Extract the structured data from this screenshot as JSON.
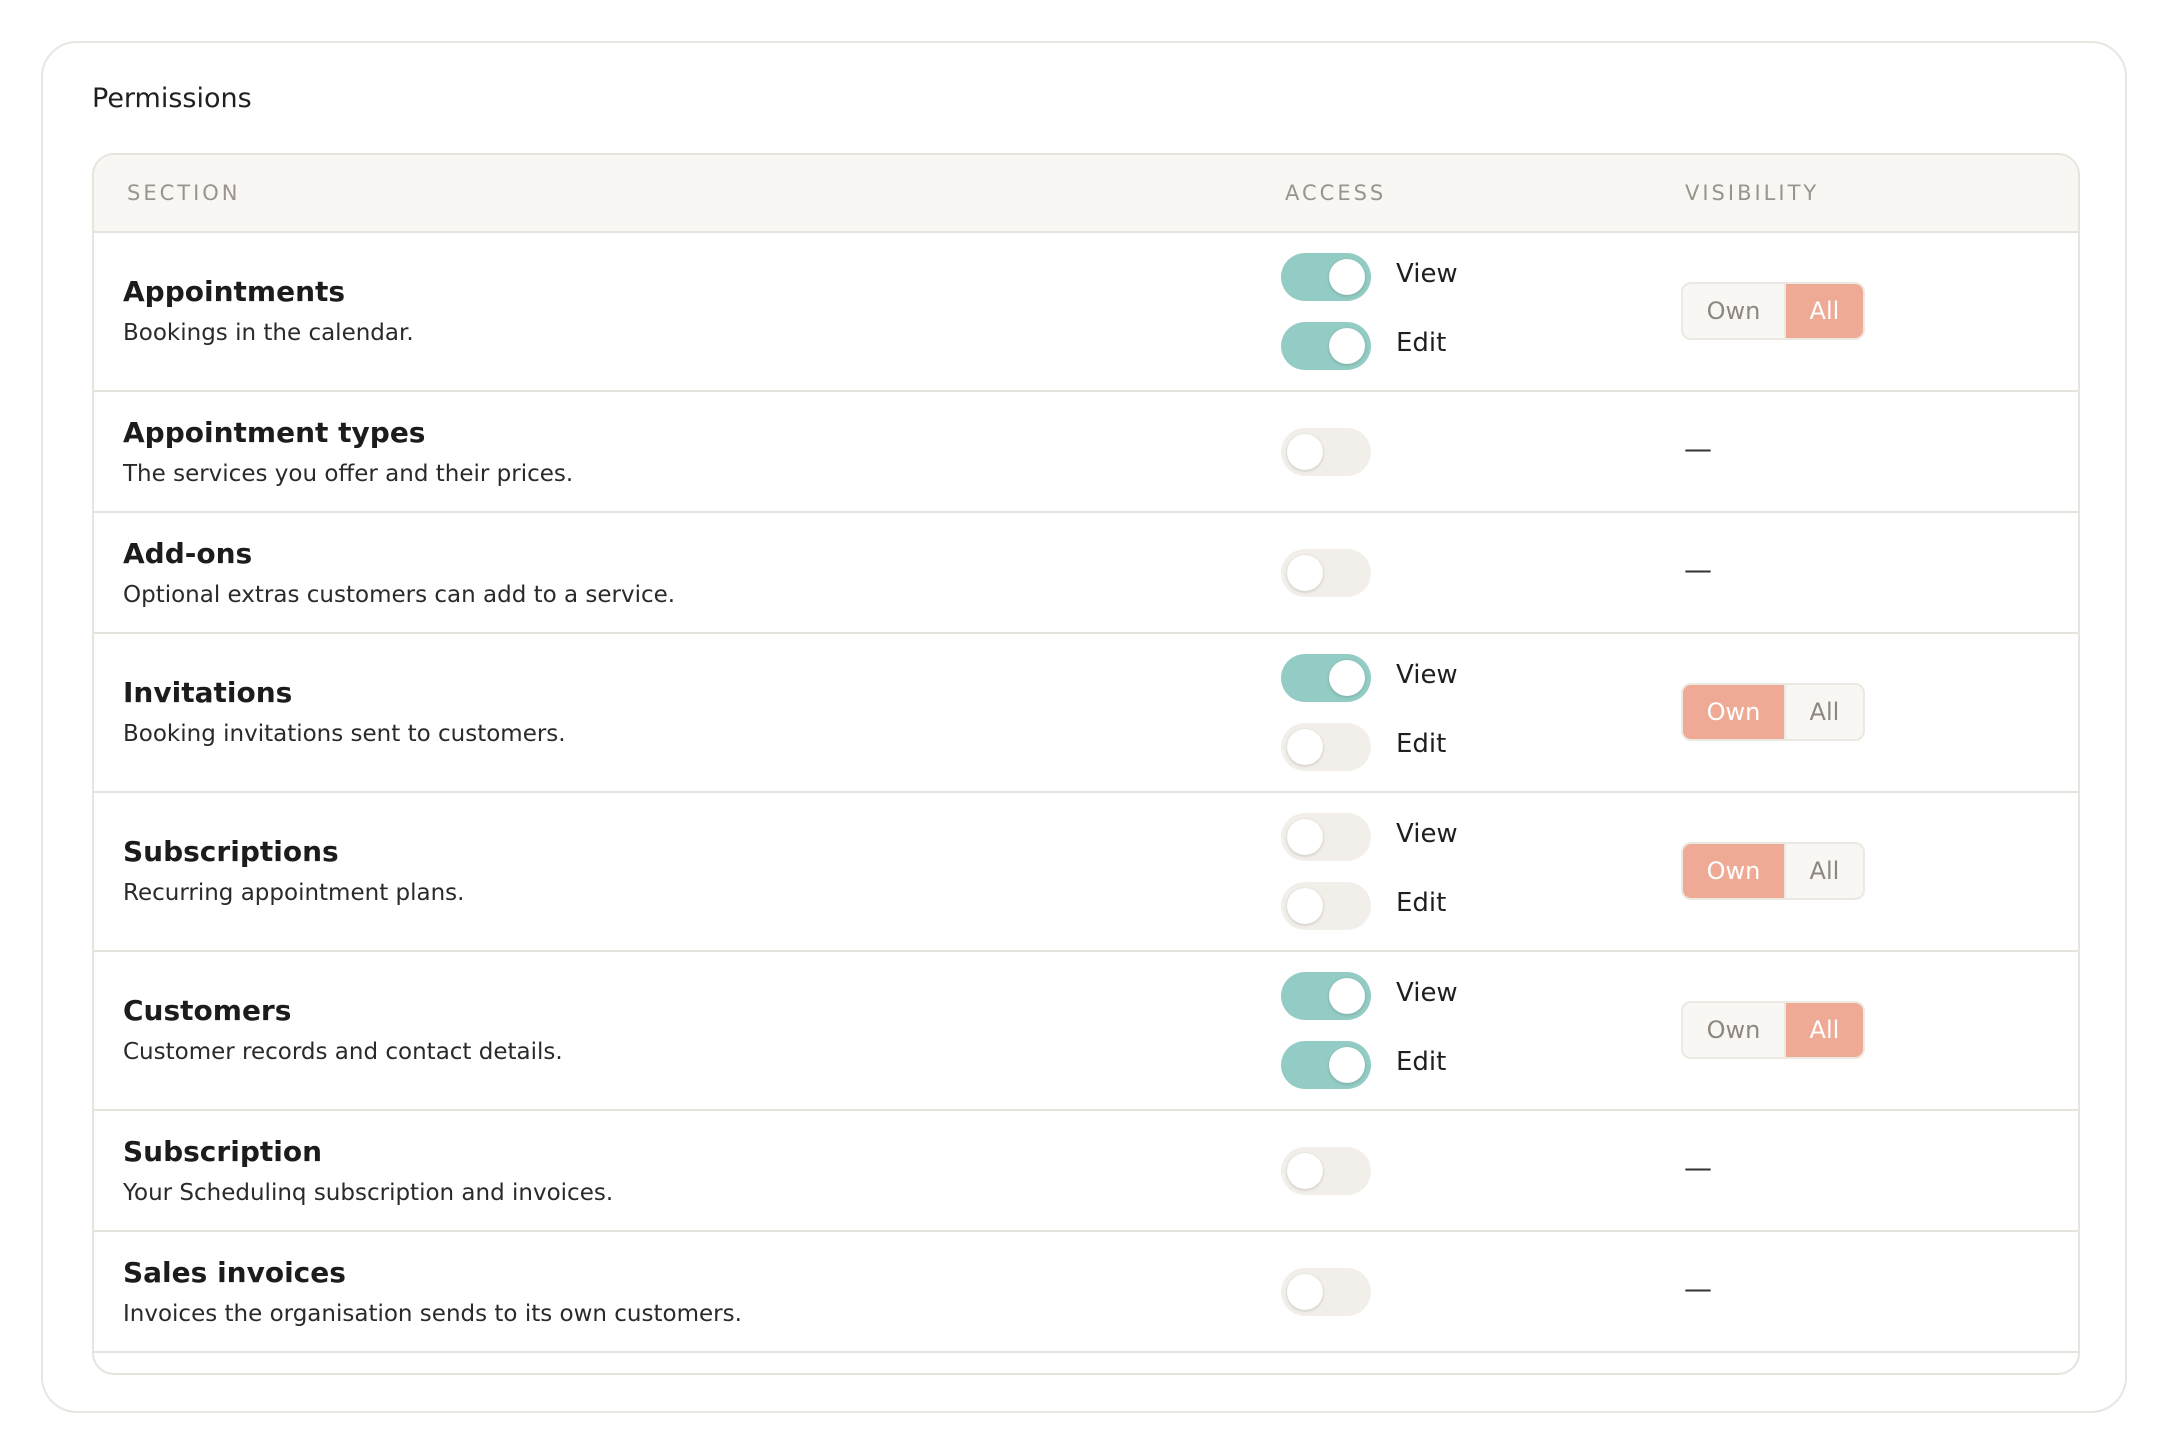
{
  "card": {
    "title": "Permissions"
  },
  "table": {
    "headers": {
      "section": "SECTION",
      "access": "ACCESS",
      "visibility": "VISIBILITY"
    },
    "rows": [
      {
        "title": "Appointments",
        "desc": "Bookings in the calendar.",
        "view": true,
        "edit": true,
        "visibility": "All"
      },
      {
        "title": "Appointment types",
        "desc": "The services you offer and their prices.",
        "enabled": false,
        "dash": "—"
      },
      {
        "title": "Add-ons",
        "desc": "Optional extras customers can add to a service.",
        "enabled": false,
        "dash": "—"
      },
      {
        "title": "Invitations",
        "desc": "Booking invitations sent to customers.",
        "view": true,
        "edit": false,
        "visibility": "Own"
      },
      {
        "title": "Subscriptions",
        "desc": "Recurring appointment plans.",
        "view": false,
        "edit": false,
        "visibility": "Own"
      },
      {
        "title": "Customers",
        "desc": "Customer records and contact details.",
        "view": true,
        "edit": true,
        "visibility": "All"
      },
      {
        "title": "Subscription",
        "desc": "Your Schedulinq subscription and invoices.",
        "enabled": false,
        "dash": "—"
      },
      {
        "title": "Sales invoices",
        "desc": "Invoices the organisation sends to its own customers.",
        "enabled": false,
        "dash": "—"
      }
    ]
  },
  "labels": {
    "view": "View",
    "edit": "Edit",
    "own": "Own",
    "all": "All"
  },
  "colors": {
    "toggle_on": "#93ccc4",
    "toggle_off": "#f2efea",
    "segment_active": "#eeaa94"
  }
}
